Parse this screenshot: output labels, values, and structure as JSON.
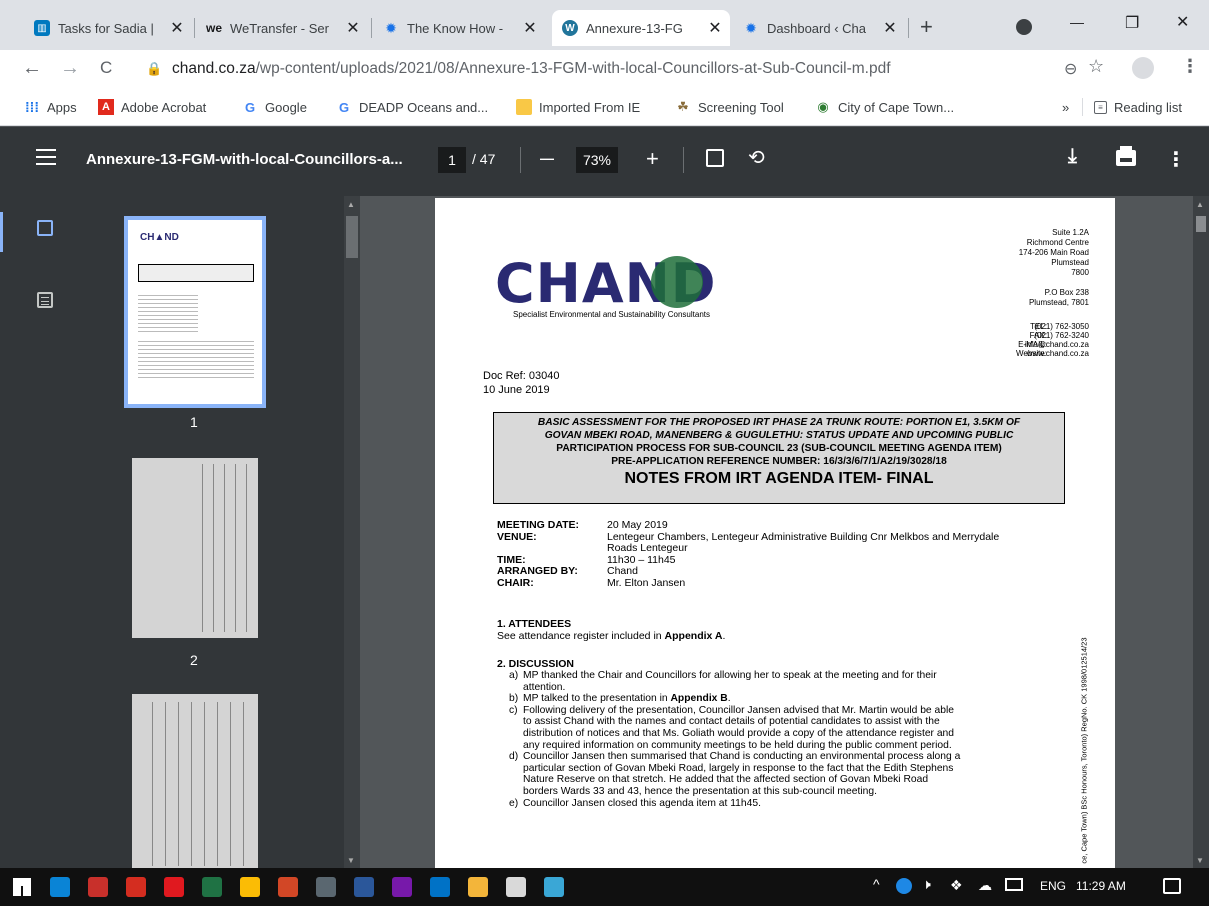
{
  "tabs": [
    {
      "label": "Tasks for Sadia |",
      "icon": "trello-icon",
      "color": "#0079bf",
      "active": false
    },
    {
      "label": "WeTransfer - Ser",
      "icon": "wetransfer-icon",
      "color": "#17181a",
      "active": false
    },
    {
      "label": "The Know How -",
      "icon": "sun-logo-icon",
      "color": "#1a73e8",
      "active": false
    },
    {
      "label": "Annexure-13-FG",
      "icon": "wordpress-icon",
      "color": "#21759b",
      "active": true
    },
    {
      "label": "Dashboard ‹ Cha",
      "icon": "sun-logo-icon",
      "color": "#1a73e8",
      "active": false
    }
  ],
  "window": {
    "new_tab": "+",
    "minimize": "—",
    "restore": "❐",
    "close": "✕"
  },
  "nav": {
    "back": "←",
    "forward": "→",
    "reload": "C",
    "url_host": "chand.co.za",
    "url_path": "/wp-content/uploads/2021/08/Annexure-13-FGM-with-local-Councillors-at-Sub-Council-m.pdf"
  },
  "bookmarks": [
    {
      "label": "Apps",
      "icon": "apps-grid-icon",
      "color": "#1a73e8"
    },
    {
      "label": "Adobe Acrobat",
      "icon": "acrobat-icon",
      "color": "#e12a1d"
    },
    {
      "label": "Google",
      "icon": "google-icon",
      "color": "#4285f4"
    },
    {
      "label": "DEADP Oceans and...",
      "icon": "google-icon",
      "color": "#4285f4"
    },
    {
      "label": "Imported From IE",
      "icon": "folder-icon",
      "color": "#f9c846"
    },
    {
      "label": "Screening Tool",
      "icon": "screening-icon",
      "color": "#8a6d3b"
    },
    {
      "label": "City of Cape Town...",
      "icon": "city-icon",
      "color": "#2e7d32"
    }
  ],
  "bookmarks_more": "»",
  "reading_list": "Reading list",
  "pdf": {
    "title": "Annexure-13-FGM-with-local-Councillors-a...",
    "page_current": "1",
    "page_total": "/ 47",
    "zoom": "73%",
    "minus": "—",
    "plus": "+"
  },
  "thumbnails": [
    {
      "label": "1"
    },
    {
      "label": "2"
    }
  ],
  "doc": {
    "address": [
      "Suite 1.2A",
      "Richmond Centre",
      "174-206 Main Road",
      "Plumstead",
      "7800",
      "",
      "P.O Box 238",
      "Plumstead, 7801"
    ],
    "contact_labels": [
      "TEL:",
      "FAX:",
      "E-MAIL:",
      "Website:"
    ],
    "contact_values": [
      "(021) 762-3050",
      "(021) 762-3240",
      "info@chand.co.za",
      "www.chand.co.za"
    ],
    "logo_text": "CHAND",
    "logo_tagline": "Specialist Environmental and Sustainability Consultants",
    "doc_ref": "Doc Ref: 03040",
    "date": "10 June 2019",
    "box_lines": [
      "BASIC ASSESSMENT FOR THE PROPOSED IRT PHASE 2A TRUNK ROUTE: PORTION E1, 3.5KM OF",
      "GOVAN MBEKI ROAD, MANENBERG & GUGULETHU: STATUS UPDATE AND UPCOMING PUBLIC",
      "PARTICIPATION PROCESS FOR SUB-COUNCIL 23 (SUB-COUNCIL MEETING AGENDA ITEM)",
      "PRE-APPLICATION REFERENCE NUMBER: 16/3/3/6/7/1/A2/19/3028/18"
    ],
    "box_title": "NOTES FROM IRT AGENDA ITEM- FINAL",
    "meta": [
      {
        "k": "MEETING DATE:",
        "v": "20 May 2019"
      },
      {
        "k": "VENUE:",
        "v": "Lentegeur Chambers, Lentegeur Administrative Building Cnr Melkbos and Merrydale"
      },
      {
        "k": "",
        "v": "Roads Lentegeur"
      },
      {
        "k": "TIME:",
        "v": "11h30 – 11h45"
      },
      {
        "k": "ARRANGED BY:",
        "v": "Chand"
      },
      {
        "k": "CHAIR:",
        "v": "Mr. Elton Jansen"
      }
    ],
    "s1_title": "1.   ATTENDEES",
    "s1_text": "See attendance register included in ",
    "s1_bold": "Appendix A",
    "s1_end": ".",
    "s2_title": "2.   DISCUSSION",
    "s2_lines": [
      {
        "m": "a)",
        "t": "MP thanked the Chair and Councillors for allowing her to speak at the meeting and for their"
      },
      {
        "m": "",
        "t": "attention."
      },
      {
        "m": "b)",
        "t": "MP talked to the presentation in ",
        "b": "Appendix B",
        "e": "."
      },
      {
        "m": "c)",
        "t": "Following delivery of the presentation, Councillor Jansen advised that Mr. Martin would be able"
      },
      {
        "m": "",
        "t": "to assist Chand with the names and contact details of potential candidates to assist with the"
      },
      {
        "m": "",
        "t": "distribution of notices and that Ms. Goliath would provide a copy of the attendance register and"
      },
      {
        "m": "",
        "t": "any required information on community meetings to be held during the public comment period."
      },
      {
        "m": "d)",
        "t": "Councillor Jansen then summarised that Chand is conducting an environmental process along a"
      },
      {
        "m": "",
        "t": "particular section of Govan Mbeki Road, largely in response to the fact that the Edith Stephens"
      },
      {
        "m": "",
        "t": "Nature Reserve on that stretch.  He added that the affected section of Govan Mbeki Road"
      },
      {
        "m": "",
        "t": "borders Wards 33 and 43, hence the presentation at this sub-council meeting."
      },
      {
        "m": "e)",
        "t": "Councillor Jansen closed this agenda item at 11h45."
      }
    ],
    "side_text": "ce, Cape Town) BSc Honours, Toronto) RegNo. CK 1998/012514/23"
  },
  "taskbar": {
    "apps": [
      {
        "name": "start-icon",
        "color": "#ffffff"
      },
      {
        "name": "app-blue-icon",
        "color": "#0a84d6"
      },
      {
        "name": "app-red-icon",
        "color": "#c8302b"
      },
      {
        "name": "acrobat-taskbar-icon",
        "color": "#d42d20"
      },
      {
        "name": "opera-icon",
        "color": "#e0191f"
      },
      {
        "name": "excel-icon",
        "color": "#1f7244"
      },
      {
        "name": "chrome-icon",
        "color": "#fbbc05"
      },
      {
        "name": "powerpoint-icon",
        "color": "#d24726"
      },
      {
        "name": "wordpress-taskbar-icon",
        "color": "#5a6770"
      },
      {
        "name": "word-icon",
        "color": "#2b579a"
      },
      {
        "name": "onenote-icon",
        "color": "#7719aa"
      },
      {
        "name": "outlook-icon",
        "color": "#0072c6"
      },
      {
        "name": "file-explorer-icon",
        "color": "#f3b53a"
      },
      {
        "name": "notes-icon",
        "color": "#d9d9d9"
      },
      {
        "name": "edge-icon",
        "color": "#3aa7d6"
      }
    ],
    "lang": "ENG",
    "time": "11:29 AM"
  }
}
